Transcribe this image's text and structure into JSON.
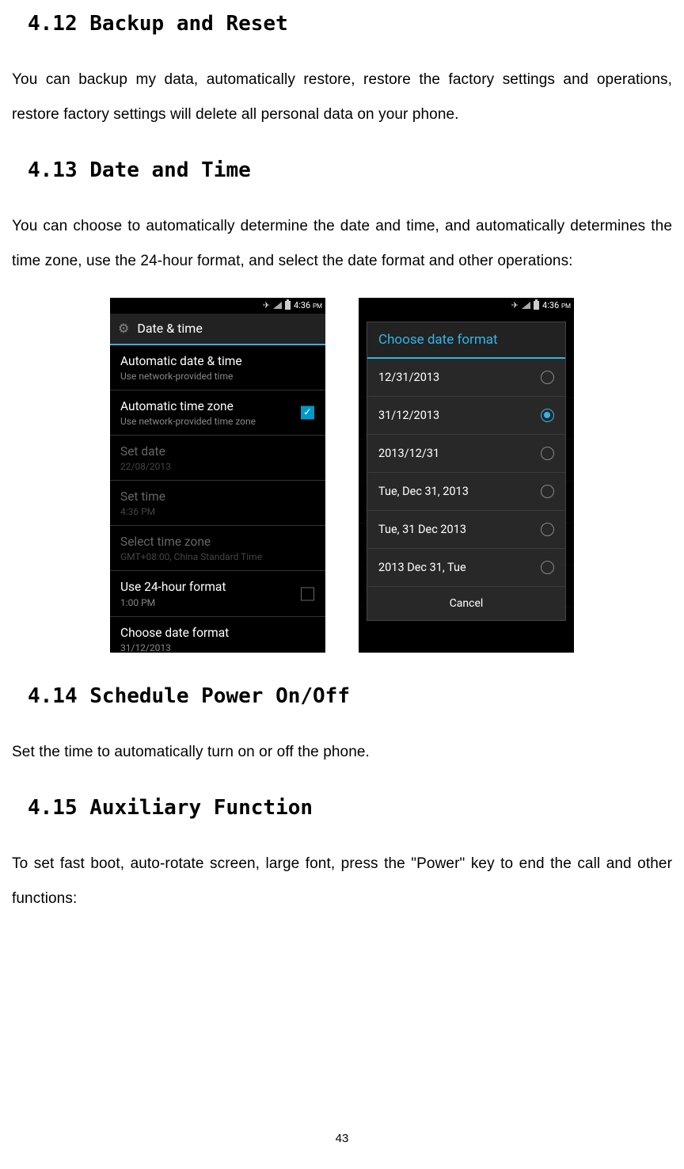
{
  "sections": {
    "s412": {
      "heading": "4.12 Backup and Reset",
      "body": "You can backup my data, automatically restore, restore the factory settings and operations, restore factory settings will delete all personal data on your phone."
    },
    "s413": {
      "heading": "4.13 Date and Time",
      "body": "You can choose to automatically determine the date and time, and automatically determines the time zone, use the 24-hour format, and select the date format and other operations:"
    },
    "s414": {
      "heading": "4.14 Schedule Power On/Off",
      "body": "Set the time to automatically turn on or off the phone."
    },
    "s415": {
      "heading": "4.15 Auxiliary Function",
      "body": "To set fast boot, auto-rotate screen, large font, press the \"Power\" key to end the call and other functions:"
    }
  },
  "screenshot1": {
    "status_time": "4:36",
    "status_ampm": "PM",
    "header_title": "Date & time",
    "items": [
      {
        "label": "Automatic date & time",
        "sub": "Use network-provided time",
        "disabled": false,
        "checkbox": null
      },
      {
        "label": "Automatic time zone",
        "sub": "Use network-provided time zone",
        "disabled": false,
        "checkbox": "checked"
      },
      {
        "label": "Set date",
        "sub": "22/08/2013",
        "disabled": true,
        "checkbox": null
      },
      {
        "label": "Set time",
        "sub": "4:36 PM",
        "disabled": true,
        "checkbox": null
      },
      {
        "label": "Select time zone",
        "sub": "GMT+08:00, China Standard Time",
        "disabled": true,
        "checkbox": null
      },
      {
        "label": "Use 24-hour format",
        "sub": "1:00 PM",
        "disabled": false,
        "checkbox": "unchecked"
      },
      {
        "label": "Choose date format",
        "sub": "31/12/2013",
        "disabled": false,
        "checkbox": null
      }
    ]
  },
  "screenshot2": {
    "status_time": "4:36",
    "status_ampm": "PM",
    "dialog_title": "Choose date format",
    "options": [
      {
        "label": "12/31/2013",
        "selected": false
      },
      {
        "label": "31/12/2013",
        "selected": true
      },
      {
        "label": "2013/12/31",
        "selected": false
      },
      {
        "label": "Tue, Dec 31, 2013",
        "selected": false
      },
      {
        "label": "Tue, 31 Dec 2013",
        "selected": false
      },
      {
        "label": "2013 Dec 31, Tue",
        "selected": false
      }
    ],
    "cancel_label": "Cancel"
  },
  "page_number": "43"
}
